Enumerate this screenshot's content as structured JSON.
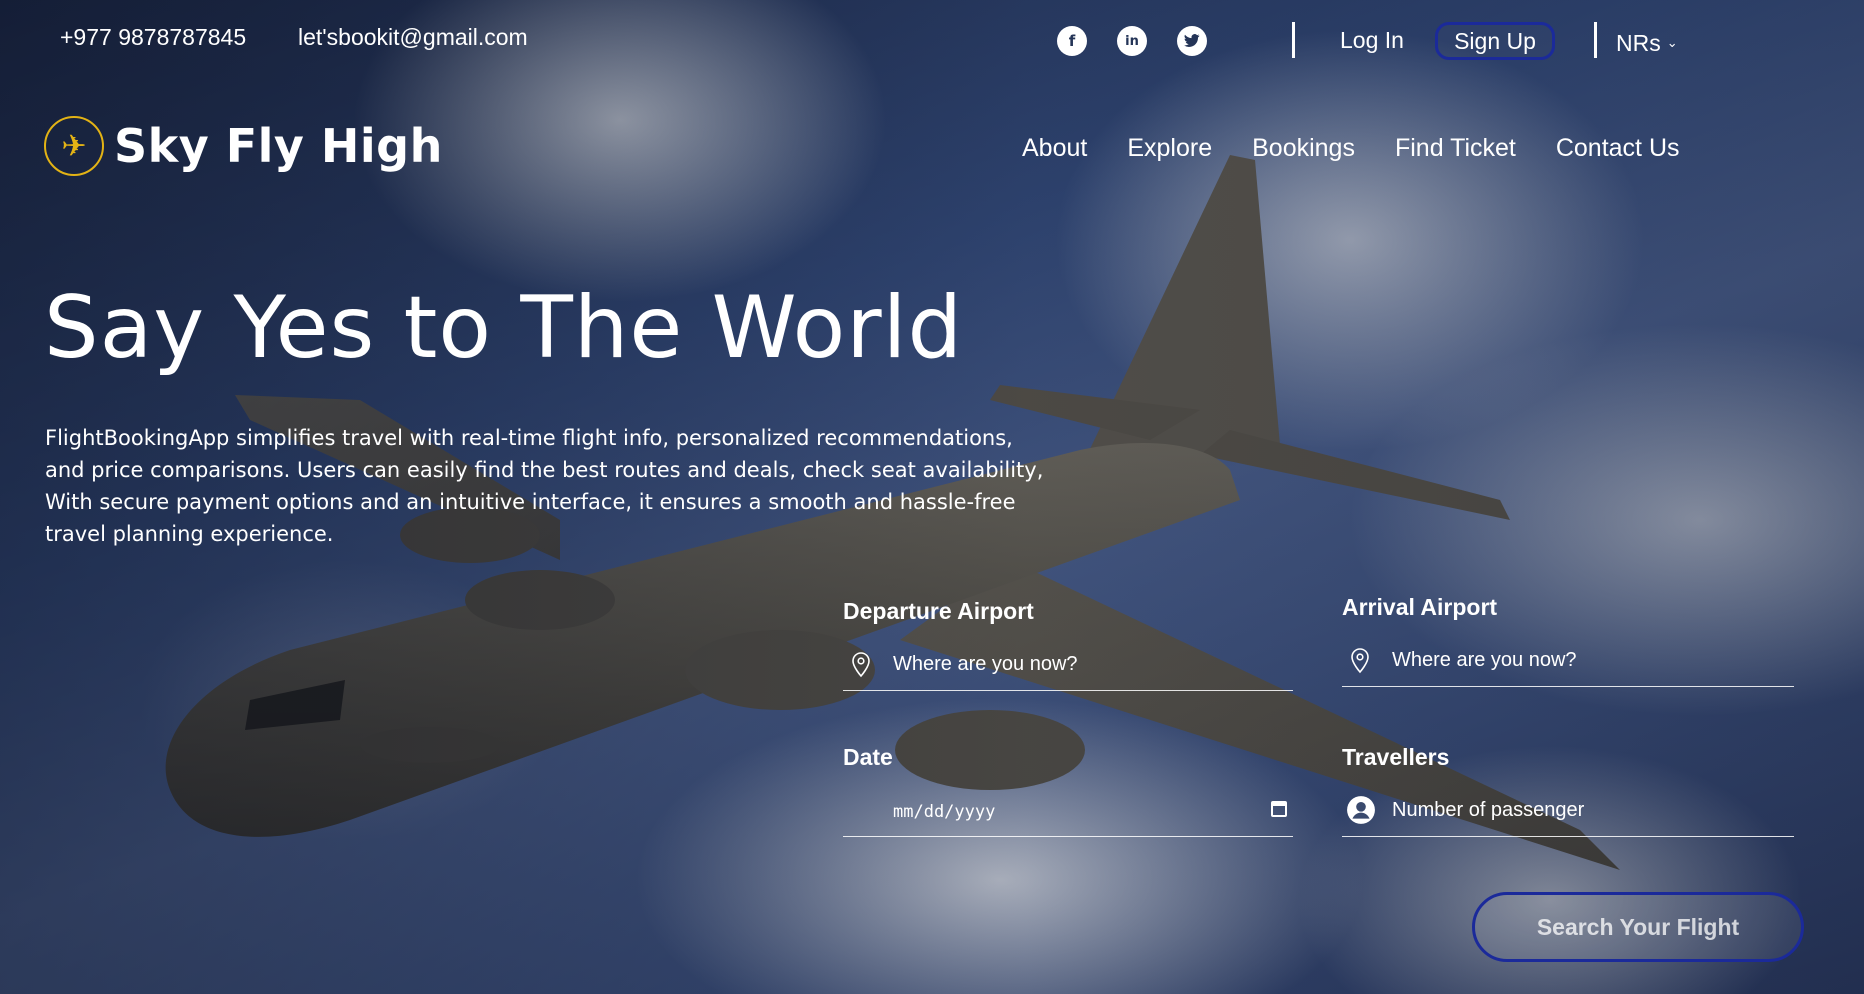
{
  "topbar": {
    "phone": "+977 9878787845",
    "email": "let'sbookit@gmail.com",
    "social": [
      "facebook-icon",
      "linkedin-icon",
      "twitter-icon"
    ],
    "login": "Log In",
    "signup": "Sign Up",
    "currency": "NRs"
  },
  "brand": {
    "name": "Sky Fly High"
  },
  "nav": [
    "About",
    "Explore",
    "Bookings",
    "Find Ticket",
    "Contact Us"
  ],
  "hero": {
    "headline": "Say Yes to The World",
    "description": "FlightBookingApp simplifies travel with real-time flight info, personalized recommendations, and price comparisons. Users can easily find the best routes and deals, check seat availability, With secure payment options and an intuitive interface, it ensures a smooth and hassle-free travel planning experience."
  },
  "form": {
    "departure": {
      "label": "Departure Airport",
      "placeholder": "Where are you now?"
    },
    "arrival": {
      "label": "Arrival Airport",
      "placeholder": "Where are you now?"
    },
    "date": {
      "label": "Date",
      "placeholder": "mm/dd/yyyy"
    },
    "travellers": {
      "label": "Travellers",
      "placeholder": "Number of passenger"
    },
    "submit": "Search Your Flight"
  },
  "colors": {
    "accent_border": "#1b2a9a",
    "logo_gold": "#e3b315"
  }
}
